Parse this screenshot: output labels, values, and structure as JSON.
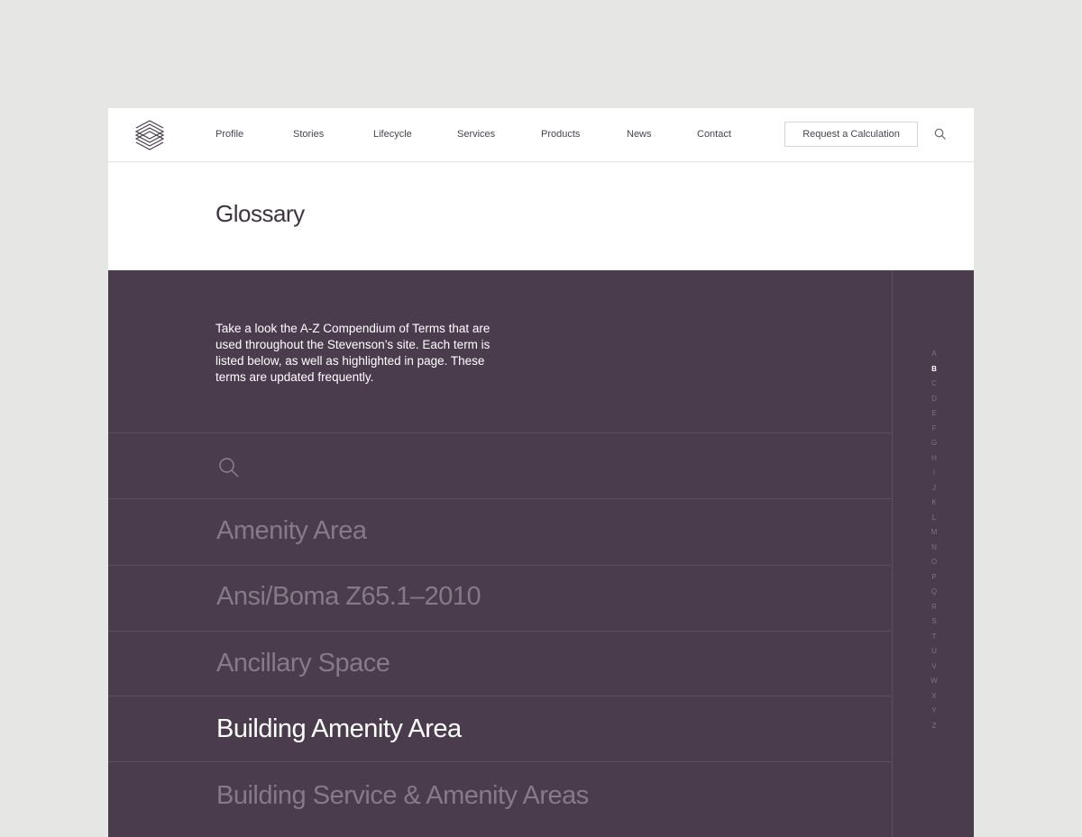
{
  "header": {
    "nav": [
      "Profile",
      "Stories",
      "Lifecycle",
      "Services",
      "Products",
      "News",
      "Contact"
    ],
    "cta_label": "Request a Calculation"
  },
  "page": {
    "title": "Glossary"
  },
  "glossary": {
    "intro": "Take a look the A-Z Compendium of Terms that are used throughout the Stevenson’s site. Each term is listed below, as well as highlighted in page.  These terms are updated frequently.",
    "search_value": "",
    "terms": [
      {
        "label": "Amenity Area",
        "active": false
      },
      {
        "label": "Ansi/Boma Z65.1–2010",
        "active": false
      },
      {
        "label": "Ancillary Space",
        "active": false
      },
      {
        "label": "Building Amenity Area",
        "active": true
      },
      {
        "label": "Building Service & Amenity Areas",
        "active": false
      }
    ],
    "alphabet": [
      "A",
      "B",
      "C",
      "D",
      "E",
      "F",
      "G",
      "H",
      "I",
      "J",
      "K",
      "L",
      "M",
      "N",
      "O",
      "P",
      "Q",
      "R",
      "S",
      "T",
      "U",
      "V",
      "W",
      "X",
      "Y",
      "Z"
    ],
    "active_letter": "B"
  },
  "colors": {
    "page_background": "#e6e6e4",
    "panel_background": "#4a3b4d",
    "title_text": "#3e3342",
    "inactive_term": "#867a88",
    "active_term": "#ffffff"
  },
  "icons": {
    "logo": "layered-stack-logo",
    "header_search": "search-icon",
    "glossary_search": "search-icon"
  }
}
